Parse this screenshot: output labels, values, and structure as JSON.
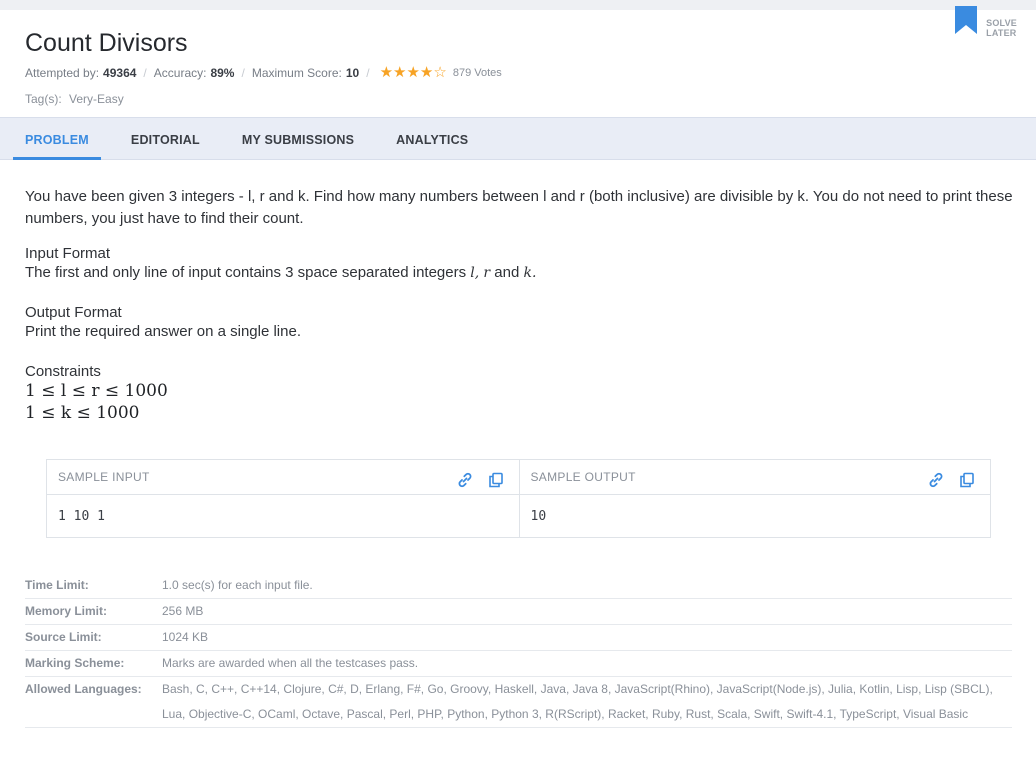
{
  "problem": {
    "title": "Count Divisors",
    "stats": {
      "attempted_label": "Attempted by:",
      "attempted_value": "49364",
      "accuracy_label": "Accuracy:",
      "accuracy_value": "89%",
      "max_score_label": "Maximum Score:",
      "max_score_value": "10",
      "rating": 4,
      "rating_max": 5,
      "votes": "879 Votes"
    },
    "tags_label": "Tag(s):",
    "tags_value": "Very-Easy",
    "solve_later_line1": "SOLVE",
    "solve_later_line2": "LATER"
  },
  "tabs": [
    {
      "label": "PROBLEM",
      "active": true
    },
    {
      "label": "EDITORIAL",
      "active": false
    },
    {
      "label": "MY SUBMISSIONS",
      "active": false
    },
    {
      "label": "ANALYTICS",
      "active": false
    }
  ],
  "statement": {
    "description": "You have been given 3 integers - l, r and k. Find how many numbers between l and r (both inclusive) are divisible by k. You do not need to print these numbers, you just have to find their count.",
    "input_format_title": "Input Format",
    "input_format_prefix": "The first and only line of input contains 3 space separated integers ",
    "input_var_l": "l,",
    "input_var_r": "r",
    "input_and": " and ",
    "input_var_k": "k.",
    "output_format_title": "Output Format",
    "output_format_body": "Print the required answer on a single line.",
    "constraints_title": "Constraints",
    "constraint1": "1 ≤ l ≤ r ≤ 1000",
    "constraint2": "1 ≤ k ≤ 1000"
  },
  "samples": {
    "input_label": "SAMPLE INPUT",
    "output_label": "SAMPLE OUTPUT",
    "input_value": "1 10 1",
    "output_value": "10"
  },
  "limits": [
    {
      "key": "Time Limit:",
      "value": "1.0 sec(s) for each input file."
    },
    {
      "key": "Memory Limit:",
      "value": "256 MB"
    },
    {
      "key": "Source Limit:",
      "value": "1024 KB"
    },
    {
      "key": "Marking Scheme:",
      "value": "Marks are awarded when all the testcases pass."
    },
    {
      "key": "Allowed Languages:",
      "value": "Bash, C, C++, C++14, Clojure, C#, D, Erlang, F#, Go, Groovy, Haskell, Java, Java 8, JavaScript(Rhino), JavaScript(Node.js), Julia, Kotlin, Lisp, Lisp (SBCL), Lua, Objective-C, OCaml, Octave, Pascal, Perl, PHP, Python, Python 3, R(RScript), Racket, Ruby, Rust, Scala, Swift, Swift-4.1, TypeScript, Visual Basic"
    }
  ],
  "colors": {
    "accent": "#3a8be0",
    "star": "#f7a325",
    "tab_bar": "#e9edf6"
  }
}
